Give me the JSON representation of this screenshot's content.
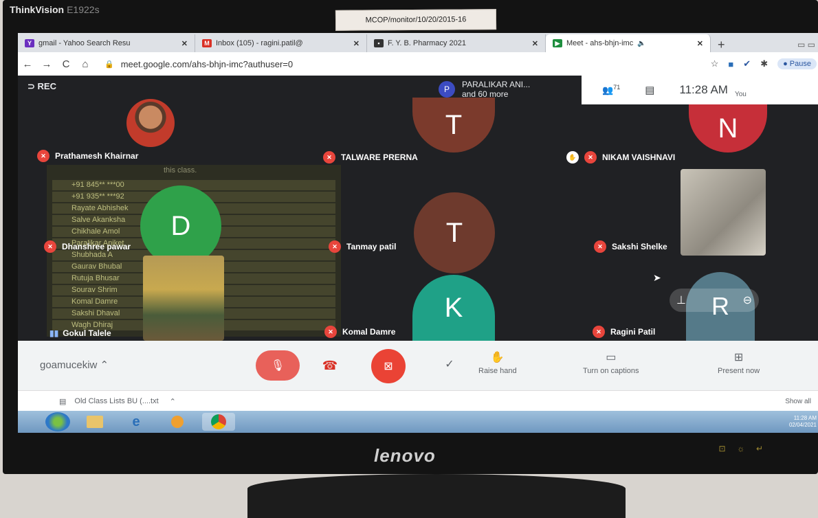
{
  "monitor": {
    "brand_top": "ThinkVision",
    "model": "E1922s",
    "sticker": "MCOP/monitor/10/20/2015-16",
    "brand_bottom": "lenovo"
  },
  "browser": {
    "tabs": [
      {
        "label": "gmail - Yahoo Search Resu",
        "fav_color": "#6b2fbf",
        "fav_text": "Y"
      },
      {
        "label": "Inbox (105) - ragini.patil@",
        "fav_color": "#d93025",
        "fav_text": "M"
      },
      {
        "label": "F. Y. B. Pharmacy 2021",
        "fav_color": "#333333",
        "fav_text": "▪"
      },
      {
        "label": "Meet - ahs-bhjn-imc",
        "fav_color": "#1e8e3e",
        "fav_text": "▶"
      }
    ],
    "url": "meet.google.com/ahs-bhjn-imc?authuser=0",
    "pause_label": "Pause"
  },
  "meet": {
    "rec_label": "REC",
    "presenter_initial": "P",
    "presenter_line1": "PARALIKAR ANI...",
    "presenter_line2": "and 60 more",
    "people_count": "71",
    "time": "11:28 AM",
    "you_label": "You",
    "participants": [
      {
        "name": "Prathamesh Khairnar"
      },
      {
        "name": "TALWARE PRERNA",
        "initial": "T",
        "color": "#7b3a2c"
      },
      {
        "name": "NIKAM VAISHNAVI",
        "initial": "N",
        "color": "#c62f39"
      },
      {
        "name": "Dhanshree pawar",
        "initial": "D",
        "color": "#2fa14a"
      },
      {
        "name": "Tanmay patil",
        "initial": "T",
        "color": "#6e3a2d"
      },
      {
        "name": "Sakshi Shelke"
      },
      {
        "name": "Gokul Talele"
      },
      {
        "name": "Komal Damre",
        "initial": "K",
        "color": "#1fa187"
      },
      {
        "name": "Ragini Patil",
        "initial": "R",
        "color": "#557a89"
      }
    ],
    "list_header": "this class.",
    "list_rows": [
      "+91 845** ***00",
      "+91 935** ***92",
      "Rayate Abhishek",
      "Salve Akanksha",
      "Chikhale Amol",
      "Paralikar Aniket",
      "Shubhada A",
      "Gaurav Bhubal",
      "Rutuja Bhusar",
      "Sourav Shrim",
      "Komal Damre",
      "Sakshi Dhaval",
      "Wagh Dhiraj"
    ]
  },
  "controls": {
    "meeting_code": "goamucekiw",
    "raise_hand": "Raise hand",
    "captions": "Turn on captions",
    "present": "Present now"
  },
  "downloads": {
    "file": "Old Class Lists BU (....txt",
    "show_all": "Show all"
  },
  "taskbar": {
    "time": "11:28 AM",
    "date": "02/04/2021"
  }
}
